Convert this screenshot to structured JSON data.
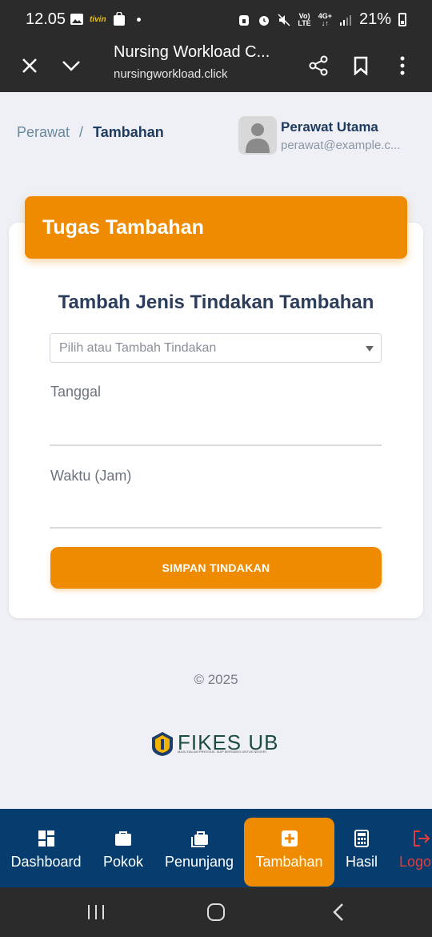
{
  "status_bar": {
    "time": "12.05",
    "battery": "21%",
    "net_top": "Vo)",
    "net_bottom": "LTE",
    "net2_top": "4G+"
  },
  "browser": {
    "title": "Nursing Workload C...",
    "url": "nursingworkload.click"
  },
  "breadcrumb": {
    "parent": "Perawat",
    "separator": "/",
    "current": "Tambahan"
  },
  "user": {
    "name": "Perawat Utama",
    "email": "perawat@example.c..."
  },
  "card": {
    "header": "Tugas Tambahan",
    "form_title": "Tambah Jenis Tindakan Tambahan",
    "select_placeholder": "Pilih atau Tambah Tindakan",
    "date_label": "Tanggal",
    "time_label": "Waktu (Jam)",
    "save_button": "SIMPAN TINDAKAN"
  },
  "footer": {
    "copyright": "© 2025",
    "logo_text": "FIKES UB",
    "logo_tagline": "MAJU DALAM PRESTASI, SIAP BERSAING UNTUK NEGERI"
  },
  "bottom_nav": {
    "items": [
      {
        "label": "Dashboard",
        "icon": "dashboard-icon"
      },
      {
        "label": "Pokok",
        "icon": "briefcase-icon"
      },
      {
        "label": "Penunjang",
        "icon": "briefcases-icon"
      },
      {
        "label": "Tambahan",
        "icon": "plus-square-icon",
        "active": true
      },
      {
        "label": "Hasil",
        "icon": "calculator-icon"
      },
      {
        "label": "Logo",
        "icon": "logout-icon"
      }
    ]
  },
  "colors": {
    "accent": "#ee8b00",
    "nav_bg": "#063d6e",
    "title": "#2d3e5c",
    "logout": "#e33b3b"
  }
}
